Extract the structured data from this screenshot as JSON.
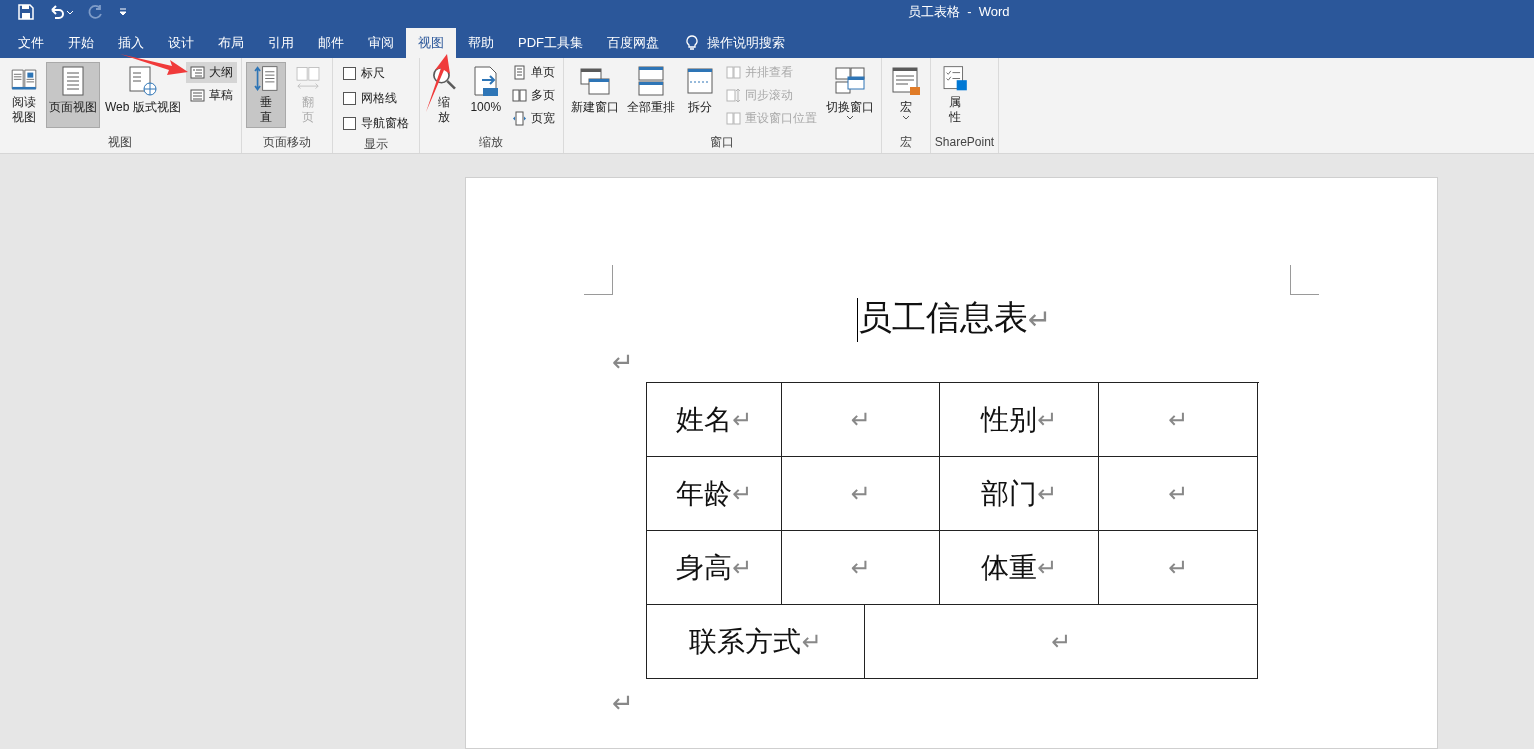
{
  "window": {
    "title": "员工表格  -  Word"
  },
  "tabs": [
    {
      "label": "文件",
      "selected": false
    },
    {
      "label": "开始",
      "selected": false
    },
    {
      "label": "插入",
      "selected": false
    },
    {
      "label": "设计",
      "selected": false
    },
    {
      "label": "布局",
      "selected": false
    },
    {
      "label": "引用",
      "selected": false
    },
    {
      "label": "邮件",
      "selected": false
    },
    {
      "label": "审阅",
      "selected": false
    },
    {
      "label": "视图",
      "selected": true
    },
    {
      "label": "帮助",
      "selected": false
    },
    {
      "label": "PDF工具集",
      "selected": false
    },
    {
      "label": "百度网盘",
      "selected": false
    }
  ],
  "tell_me": {
    "placeholder": "操作说明搜索"
  },
  "ribbon_groups": [
    {
      "label": "视图",
      "items": [
        {
          "kind": "tall",
          "label": "阅读视图",
          "selected": false
        },
        {
          "kind": "large",
          "label": "页面视图",
          "selected": true
        },
        {
          "kind": "large",
          "label": "Web 版式视图",
          "selected": false
        },
        {
          "kind": "stack",
          "items": [
            {
              "label": "大纲",
              "highlighted": true
            },
            {
              "label": "草稿",
              "highlighted": false
            }
          ]
        }
      ]
    },
    {
      "label": "页面移动",
      "items": [
        {
          "kind": "tall",
          "label": "垂直",
          "selected": true
        },
        {
          "kind": "tall",
          "label": "翻页",
          "selected": false,
          "disabled": true
        }
      ]
    },
    {
      "label": "显示",
      "items": [
        {
          "kind": "checks",
          "items": [
            {
              "label": "标尺",
              "checked": false
            },
            {
              "label": "网格线",
              "checked": false
            },
            {
              "label": "导航窗格",
              "checked": false
            }
          ]
        }
      ]
    },
    {
      "label": "缩放",
      "items": [
        {
          "kind": "tall",
          "label": "缩放",
          "selected": false
        },
        {
          "kind": "large",
          "label": "100%",
          "selected": false
        },
        {
          "kind": "stack",
          "items": [
            {
              "label": "单页",
              "highlighted": false
            },
            {
              "label": "多页",
              "highlighted": false
            },
            {
              "label": "页宽",
              "highlighted": false
            }
          ]
        }
      ]
    },
    {
      "label": "窗口",
      "items": [
        {
          "kind": "large",
          "label": "新建窗口",
          "selected": false
        },
        {
          "kind": "large",
          "label": "全部重排",
          "selected": false
        },
        {
          "kind": "large",
          "label": "拆分",
          "selected": false
        },
        {
          "kind": "stack",
          "items": [
            {
              "label": "并排查看",
              "highlighted": false,
              "disabled": true
            },
            {
              "label": "同步滚动",
              "highlighted": false,
              "disabled": true
            },
            {
              "label": "重设窗口位置",
              "highlighted": false,
              "disabled": true
            }
          ]
        },
        {
          "kind": "large",
          "label": "切换窗口",
          "selected": false,
          "dropdown": true
        }
      ]
    },
    {
      "label": "宏",
      "items": [
        {
          "kind": "large",
          "label": "宏",
          "selected": false,
          "dropdown": true
        }
      ]
    },
    {
      "label": "SharePoint",
      "items": [
        {
          "kind": "tall",
          "label": "属性",
          "selected": false
        }
      ]
    }
  ],
  "document": {
    "title": "员工信息表",
    "title_mark": "↵",
    "blank_marks": [
      "↵",
      "↵"
    ],
    "table": {
      "rows": [
        {
          "cells": [
            {
              "text": "姓名",
              "mark": "↵"
            },
            {
              "text": "",
              "mark": "↵"
            },
            {
              "text": "性别",
              "mark": "↵"
            },
            {
              "text": "",
              "mark": "↵"
            }
          ]
        },
        {
          "cells": [
            {
              "text": "年龄",
              "mark": "↵"
            },
            {
              "text": "",
              "mark": "↵"
            },
            {
              "text": "部门",
              "mark": "↵"
            },
            {
              "text": "",
              "mark": "↵"
            }
          ]
        },
        {
          "cells": [
            {
              "text": "身高",
              "mark": "↵"
            },
            {
              "text": "",
              "mark": "↵"
            },
            {
              "text": "体重",
              "mark": "↵"
            },
            {
              "text": "",
              "mark": "↵"
            }
          ]
        },
        {
          "cells": [
            {
              "text": "联系方式",
              "mark": "↵"
            },
            {
              "text": "",
              "mark": "↵"
            }
          ]
        }
      ]
    }
  }
}
